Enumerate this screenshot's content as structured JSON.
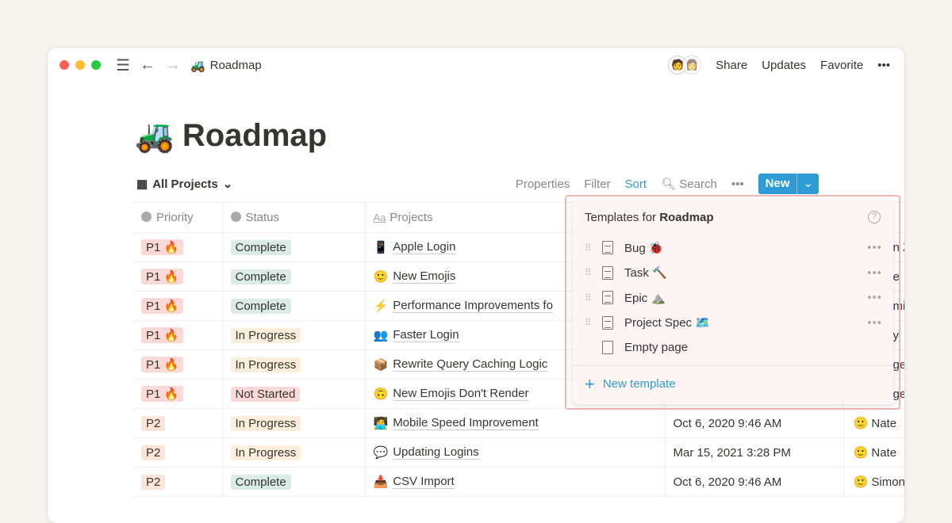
{
  "topbar": {
    "title": "Roadmap",
    "title_icon": "🚜",
    "actions": [
      "Share",
      "Updates",
      "Favorite"
    ],
    "more": "•••",
    "avatars": [
      "🧑",
      "👩"
    ]
  },
  "page": {
    "icon": "🚜",
    "title": "Roadmap"
  },
  "view": {
    "name": "All Projects",
    "tools": {
      "properties": "Properties",
      "filter": "Filter",
      "sort": "Sort",
      "search": "Search",
      "more": "•••"
    },
    "new_label": "New"
  },
  "columns": [
    "Priority",
    "Status",
    "Projects",
    "",
    ""
  ],
  "rows": [
    {
      "priority": "P1 🔥",
      "status": "Complete",
      "icon": "📱",
      "project": "Apple Login",
      "date": "",
      "person": "n Z"
    },
    {
      "priority": "P1 🔥",
      "status": "Complete",
      "icon": "🙂",
      "project": "New Emojis",
      "date": "",
      "person": "e"
    },
    {
      "priority": "P1 🔥",
      "status": "Complete",
      "icon": "⚡",
      "project": "Performance Improvements fo",
      "date": "",
      "person": "mi"
    },
    {
      "priority": "P1 🔥",
      "status": "In Progress",
      "icon": "👥",
      "project": "Faster Login",
      "date": "",
      "person": "y"
    },
    {
      "priority": "P1 🔥",
      "status": "In Progress",
      "icon": "📦",
      "project": "Rewrite Query Caching Logic",
      "date": "",
      "person": "ge"
    },
    {
      "priority": "P1 🔥",
      "status": "Not Started",
      "icon": "🙃",
      "project": "New Emojis Don't Render",
      "date": "",
      "person": "ge"
    },
    {
      "priority": "P2",
      "status": "In Progress",
      "icon": "🧑‍💻",
      "project": "Mobile Speed Improvement",
      "date": "Oct 6, 2020 9:46 AM",
      "person": "Nate"
    },
    {
      "priority": "P2",
      "status": "In Progress",
      "icon": "💬",
      "project": "Updating Logins",
      "date": "Mar 15, 2021 3:28 PM",
      "person": "Nate"
    },
    {
      "priority": "P2",
      "status": "Complete",
      "icon": "📥",
      "project": "CSV Import",
      "date": "Oct 6, 2020 9:46 AM",
      "person": "Simon"
    }
  ],
  "colors": {
    "P1": "#fbd9d7",
    "P2": "#fbe4d8",
    "Complete": "#dbece6",
    "In Progress": "#fbefdc",
    "Not Started": "#fbd9d7",
    "accent": "#2e9bd6"
  },
  "popup": {
    "title_prefix": "Templates for ",
    "title_bold": "Roadmap",
    "help": "?",
    "templates": [
      {
        "label": "Bug 🐞",
        "more": "•••"
      },
      {
        "label": "Task 🔨",
        "more": "•••"
      },
      {
        "label": "Epic ⛰️",
        "more": "•••"
      },
      {
        "label": "Project Spec 🗺️",
        "more": "•••"
      }
    ],
    "empty": "Empty page",
    "new_template": "New template"
  }
}
